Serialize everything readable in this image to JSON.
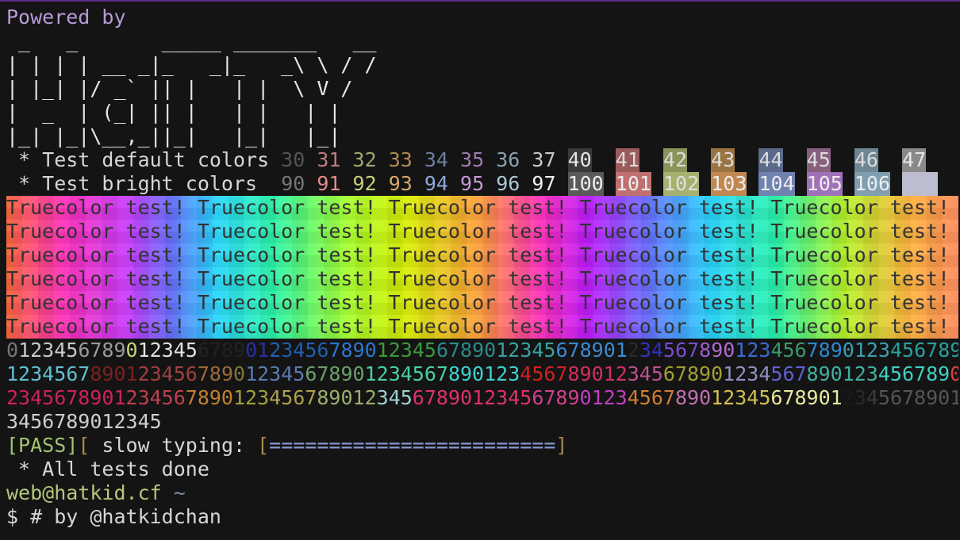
{
  "header": {
    "powered_by": "Powered by"
  },
  "ascii_logo": [
    " _   _       _____ _______   __",
    "| | | | __ _|_   _|_   _\\ \\ / /",
    "| |_| |/ _` || |   | |  \\ V /",
    "|  _  | (_| || |   | |   | |",
    "|_| |_|\\__,_||_|   |_|   |_|"
  ],
  "tests": {
    "default_label": " * Test default colors ",
    "bright_label": " * Test bright colors  ",
    "default_codes": [
      {
        "text": "30",
        "color": "#555555",
        "bg": ""
      },
      {
        "text": "31",
        "color": "#c17b7b",
        "bg": ""
      },
      {
        "text": "32",
        "color": "#9fa86b",
        "bg": ""
      },
      {
        "text": "33",
        "color": "#b08a55",
        "bg": ""
      },
      {
        "text": "34",
        "color": "#6f7f9c",
        "bg": ""
      },
      {
        "text": "35",
        "color": "#a07bb2",
        "bg": ""
      },
      {
        "text": "36",
        "color": "#8aa3b0",
        "bg": ""
      },
      {
        "text": "37",
        "color": "#c8c8c8",
        "bg": ""
      },
      {
        "text": "40",
        "color": "#e6e6e6",
        "bg": "#3a3a3a"
      },
      {
        "text": "41",
        "color": "#dddddd",
        "bg": "#9b5b5b"
      },
      {
        "text": "42",
        "color": "#dddddd",
        "bg": "#8c935a"
      },
      {
        "text": "43",
        "color": "#dddddd",
        "bg": "#9a7440"
      },
      {
        "text": "44",
        "color": "#dddddd",
        "bg": "#5b6a8a"
      },
      {
        "text": "45",
        "color": "#dddddd",
        "bg": "#86607e"
      },
      {
        "text": "46",
        "color": "#dddddd",
        "bg": "#6e8795"
      },
      {
        "text": "47",
        "color": "#e8e8e8",
        "bg": "#8a8a8a"
      }
    ],
    "bright_codes": [
      {
        "text": "90",
        "color": "#777777",
        "bg": ""
      },
      {
        "text": "91",
        "color": "#e88a8a",
        "bg": ""
      },
      {
        "text": "92",
        "color": "#c9d07a",
        "bg": ""
      },
      {
        "text": "93",
        "color": "#d9a86a",
        "bg": ""
      },
      {
        "text": "94",
        "color": "#8ea6d9",
        "bg": ""
      },
      {
        "text": "95",
        "color": "#c898d8",
        "bg": ""
      },
      {
        "text": "96",
        "color": "#a9c9d9",
        "bg": ""
      },
      {
        "text": "97",
        "color": "#f0f0f0",
        "bg": ""
      },
      {
        "text": "100",
        "color": "#eeeeee",
        "bg": "#5a5a5a"
      },
      {
        "text": "101",
        "color": "#eeeeee",
        "bg": "#c07070"
      },
      {
        "text": "102",
        "color": "#e0e0e0",
        "bg": "#a8b070"
      },
      {
        "text": "103",
        "color": "#eeeeee",
        "bg": "#c08850"
      },
      {
        "text": "104",
        "color": "#eeeeee",
        "bg": "#6f82b0"
      },
      {
        "text": "105",
        "color": "#eeeeee",
        "bg": "#a071b8"
      },
      {
        "text": "106",
        "color": "#eeeeee",
        "bg": "#7f9fb0"
      },
      {
        "text": "   ",
        "color": "#eeeeee",
        "bg": "#bdbdd0"
      }
    ]
  },
  "truecolor": {
    "phrase": "Truecolor test! Truecolor test! Truecolor test! Truecolor test! Truecolor test!",
    "rows": 6
  },
  "digits": [
    [
      {
        "t": "0",
        "c": "#777777"
      },
      {
        "t": "12345",
        "c": "#c8c8c8"
      },
      {
        "t": "6789",
        "c": "#9a9a9a"
      },
      {
        "t": "0",
        "c": "#c9d07a"
      },
      {
        "t": "12345",
        "c": "#e0e0e0"
      },
      {
        "t": "6789",
        "c": "#222222"
      },
      {
        "t": "01",
        "c": "#2b2fa0"
      },
      {
        "t": "23456",
        "c": "#1f5fb0"
      },
      {
        "t": "7890",
        "c": "#2a78d0"
      },
      {
        "t": "12345",
        "c": "#3a9a3a"
      },
      {
        "t": "67890",
        "c": "#2c8a8a"
      },
      {
        "t": "12345",
        "c": "#3aa0a0"
      },
      {
        "t": "678901",
        "c": "#3a8ad0"
      },
      {
        "t": "2",
        "c": "#2a2a2a"
      },
      {
        "t": "34",
        "c": "#3030c0"
      },
      {
        "t": "567",
        "c": "#7a4ad0"
      },
      {
        "t": "8",
        "c": "#a05ad0"
      },
      {
        "t": "90",
        "c": "#b06ad0"
      },
      {
        "t": "123",
        "c": "#3a6ad0"
      },
      {
        "t": "456",
        "c": "#3a9a6a"
      },
      {
        "t": "789",
        "c": "#2a8ad0"
      },
      {
        "t": "0123",
        "c": "#3aa0b0"
      },
      {
        "t": "456789",
        "c": "#2aa0a0"
      }
    ],
    [
      {
        "t": "1234567",
        "c": "#60c0d0"
      },
      {
        "t": "8901",
        "c": "#7a2020"
      },
      {
        "t": "23456",
        "c": "#a04040"
      },
      {
        "t": "789",
        "c": "#9a6a3a"
      },
      {
        "t": "0",
        "c": "#7a7a3a"
      },
      {
        "t": "12345",
        "c": "#5a7ab0"
      },
      {
        "t": "67890",
        "c": "#6aa06a"
      },
      {
        "t": "1234567",
        "c": "#4ad0a0"
      },
      {
        "t": "890123",
        "c": "#40d0d0"
      },
      {
        "t": "4567",
        "c": "#d02020"
      },
      {
        "t": "89012",
        "c": "#d03060"
      },
      {
        "t": "345",
        "c": "#c05090"
      },
      {
        "t": "67890",
        "c": "#a0a030"
      },
      {
        "t": "1234",
        "c": "#9090c0"
      },
      {
        "t": "567",
        "c": "#6060d0"
      },
      {
        "t": "890123",
        "c": "#40b0a0"
      },
      {
        "t": "456789",
        "c": "#40d0c0"
      },
      {
        "t": "0",
        "c": "#e04040"
      }
    ],
    [
      {
        "t": "2345678901",
        "c": "#d02060"
      },
      {
        "t": "23456",
        "c": "#c04050"
      },
      {
        "t": "7890",
        "c": "#c08030"
      },
      {
        "t": "123",
        "c": "#a0a040"
      },
      {
        "t": "4567",
        "c": "#b0a050"
      },
      {
        "t": "89012",
        "c": "#9ab06a"
      },
      {
        "t": "345",
        "c": "#a0d0d0"
      },
      {
        "t": "6789012345",
        "c": "#e03070"
      },
      {
        "t": "6789",
        "c": "#d04090"
      },
      {
        "t": "0123",
        "c": "#c040c0"
      },
      {
        "t": "4567",
        "c": "#d08030"
      },
      {
        "t": "890",
        "c": "#c070b0"
      },
      {
        "t": "12345",
        "c": "#d0c050"
      },
      {
        "t": "678901",
        "c": "#e8e8a0"
      },
      {
        "t": "2",
        "c": "#1a1a1a"
      },
      {
        "t": "3",
        "c": "#2a2a2a"
      },
      {
        "t": "4",
        "c": "#3a3a3a"
      },
      {
        "t": "5678901",
        "c": "#555555"
      }
    ],
    [
      {
        "t": "3456789012345",
        "c": "#cfcfcf"
      }
    ]
  ],
  "slow_typing": {
    "pass": "[PASS]",
    "bracket_open": "[",
    "label": " slow typing: ",
    "bar_open": "[",
    "bar": "========================",
    "bar_close": "]"
  },
  "done": " * All tests done",
  "prompt": {
    "user_host": "web@hatkid.cf",
    "path": " ~",
    "command": "$ # by @hatkidchan"
  },
  "colors": {
    "background": "#141414",
    "powered_by": "#b89ad8",
    "topbar": "#5b2a86"
  }
}
